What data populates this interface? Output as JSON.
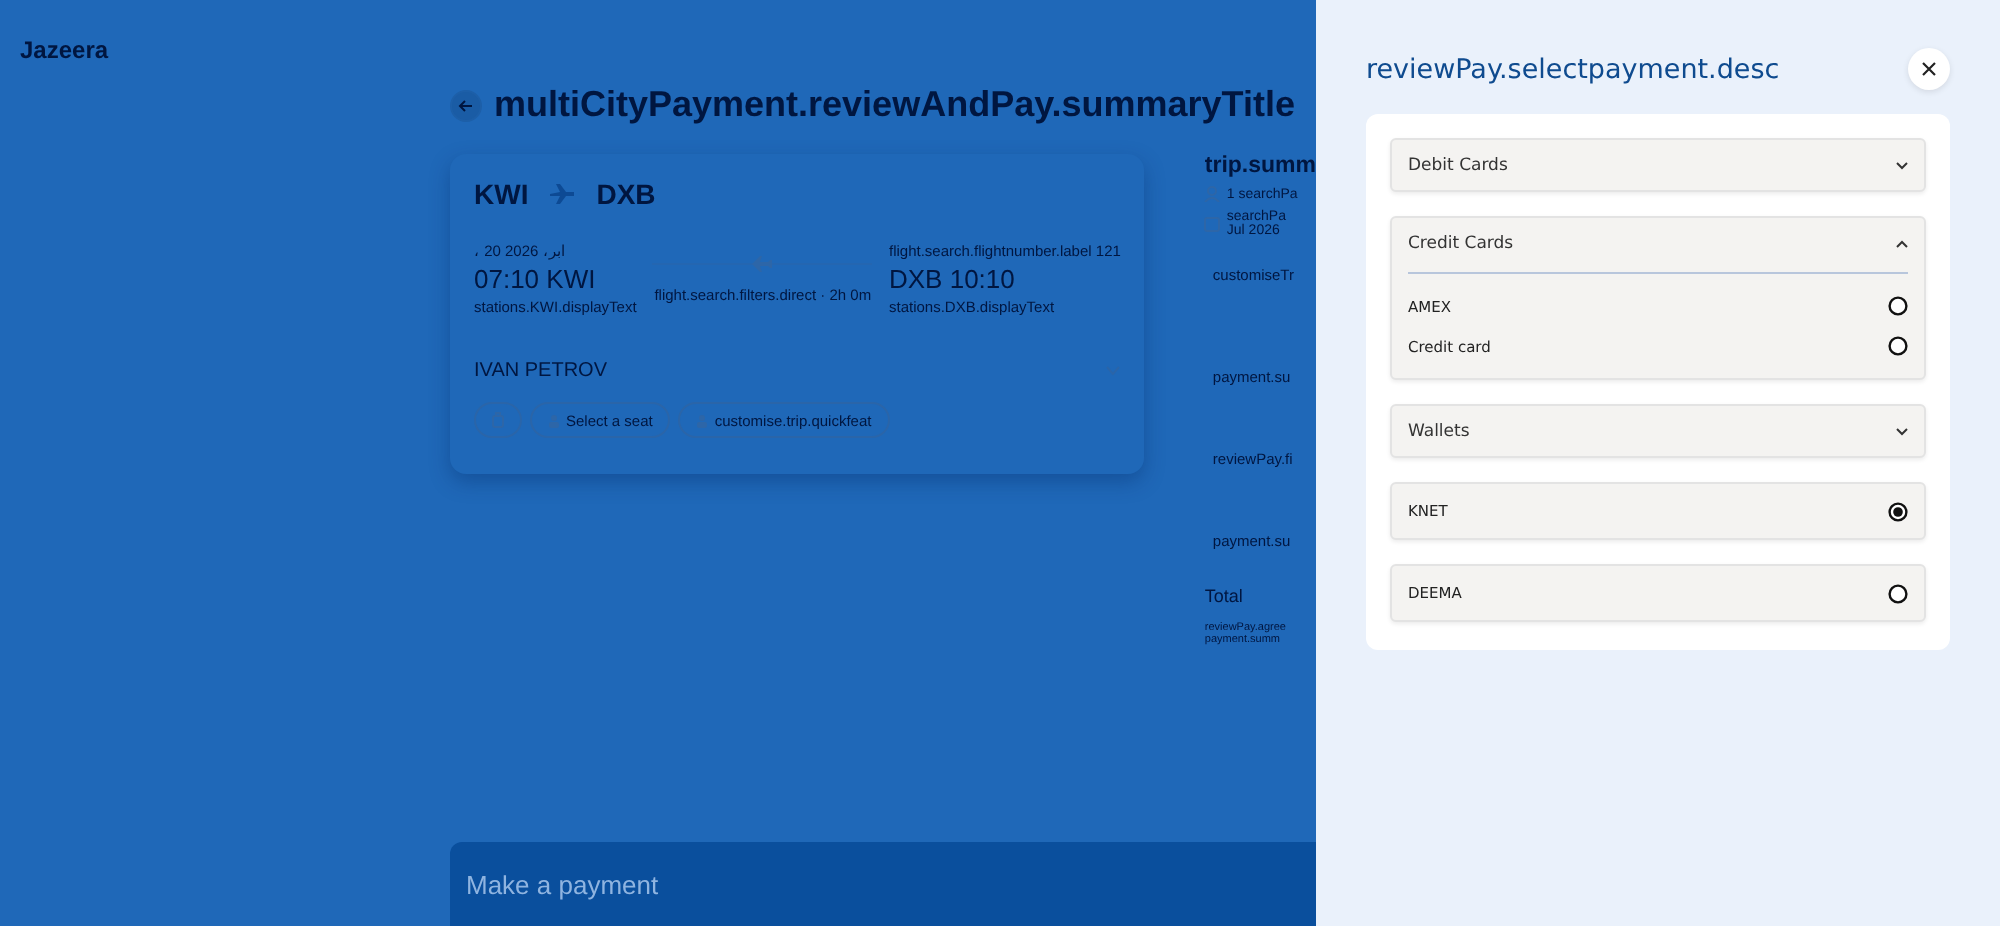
{
  "logo": {
    "text": "Jazeera"
  },
  "page": {
    "title": "multiCityPayment.reviewAndPay.summaryTitle"
  },
  "flight": {
    "from": "KWI",
    "to": "DXB",
    "date": "، 20 ابر، 2026",
    "departure_time": "07:10 KWI",
    "departure_station": "stations.KWI.displayText",
    "duration": "flight.search.filters.direct · 2h 0m",
    "flight_number": "flight.search.flightnumber.label 121",
    "arrival_time": "DXB 10:10",
    "arrival_station": "stations.DXB.displayText",
    "passenger": "IVAN PETROV",
    "chips": [
      "Select a seat",
      "customise.trip.quickfeat"
    ]
  },
  "summary": {
    "title": "trip.summ",
    "passengers": "1 searchPa",
    "dates": [
      "searchPa",
      "Jul 2026"
    ],
    "rows": [
      "customiseTr",
      "payment.su",
      "reviewPay.fi",
      "payment.su"
    ],
    "total": "Total",
    "terms": [
      "reviewPay.agree",
      "payment.summ"
    ]
  },
  "footer": {
    "label": "Make a payment"
  },
  "drawer": {
    "title": "reviewPay.selectpayment.desc",
    "items": [
      {
        "kind": "group",
        "label": "Debit Cards",
        "expanded": false
      },
      {
        "kind": "group",
        "label": "Credit Cards",
        "expanded": true,
        "options": [
          {
            "label": "AMEX",
            "selected": false
          },
          {
            "label": "Credit card",
            "selected": false
          }
        ]
      },
      {
        "kind": "group",
        "label": "Wallets",
        "expanded": false
      },
      {
        "kind": "option",
        "label": "KNET",
        "selected": true
      },
      {
        "kind": "option",
        "label": "DEEMA",
        "selected": false
      }
    ]
  }
}
